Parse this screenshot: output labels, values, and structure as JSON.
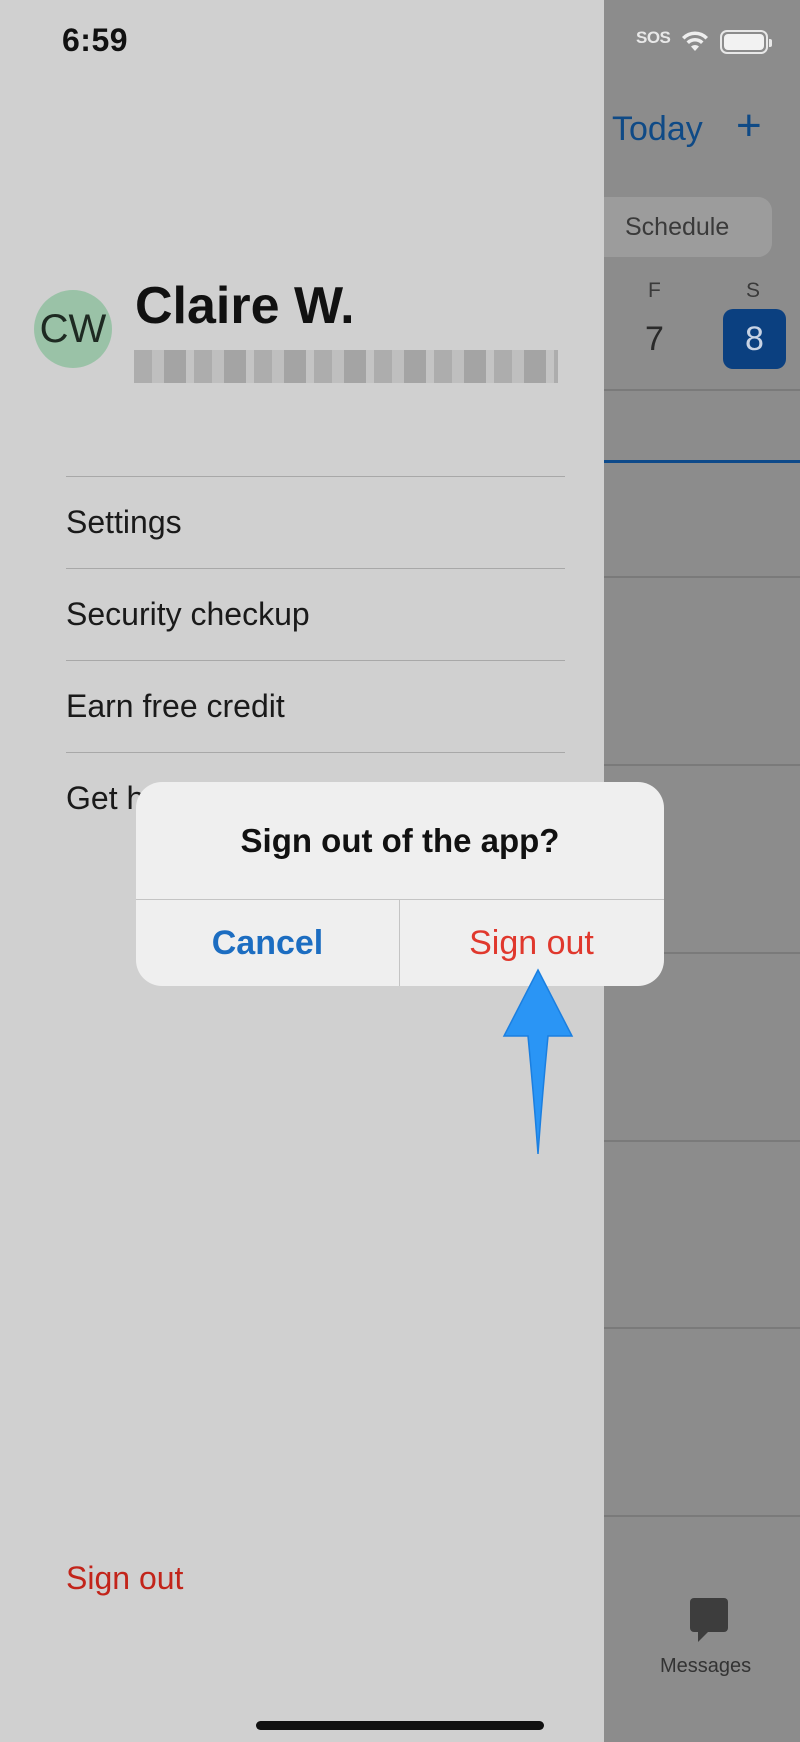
{
  "status_bar": {
    "time": "6:59",
    "carrier": "SOS"
  },
  "background": {
    "today_label": "Today",
    "add_label": "+",
    "segment_label": "Schedule",
    "days": [
      {
        "letter": "F",
        "number": "7"
      },
      {
        "letter": "S",
        "number": "8"
      }
    ],
    "tab_label": "Messages"
  },
  "profile": {
    "initials": "CW",
    "name": "Claire W."
  },
  "menu": {
    "items": [
      "Settings",
      "Security checkup",
      "Earn free credit",
      "Get h"
    ]
  },
  "drawer_signout_label": "Sign out",
  "dialog": {
    "title": "Sign out of the app?",
    "cancel_label": "Cancel",
    "signout_label": "Sign out"
  },
  "colors": {
    "accent_blue": "#1c6dc1",
    "destructive_red": "#e0382d",
    "annotation_arrow": "#2a95f5"
  }
}
